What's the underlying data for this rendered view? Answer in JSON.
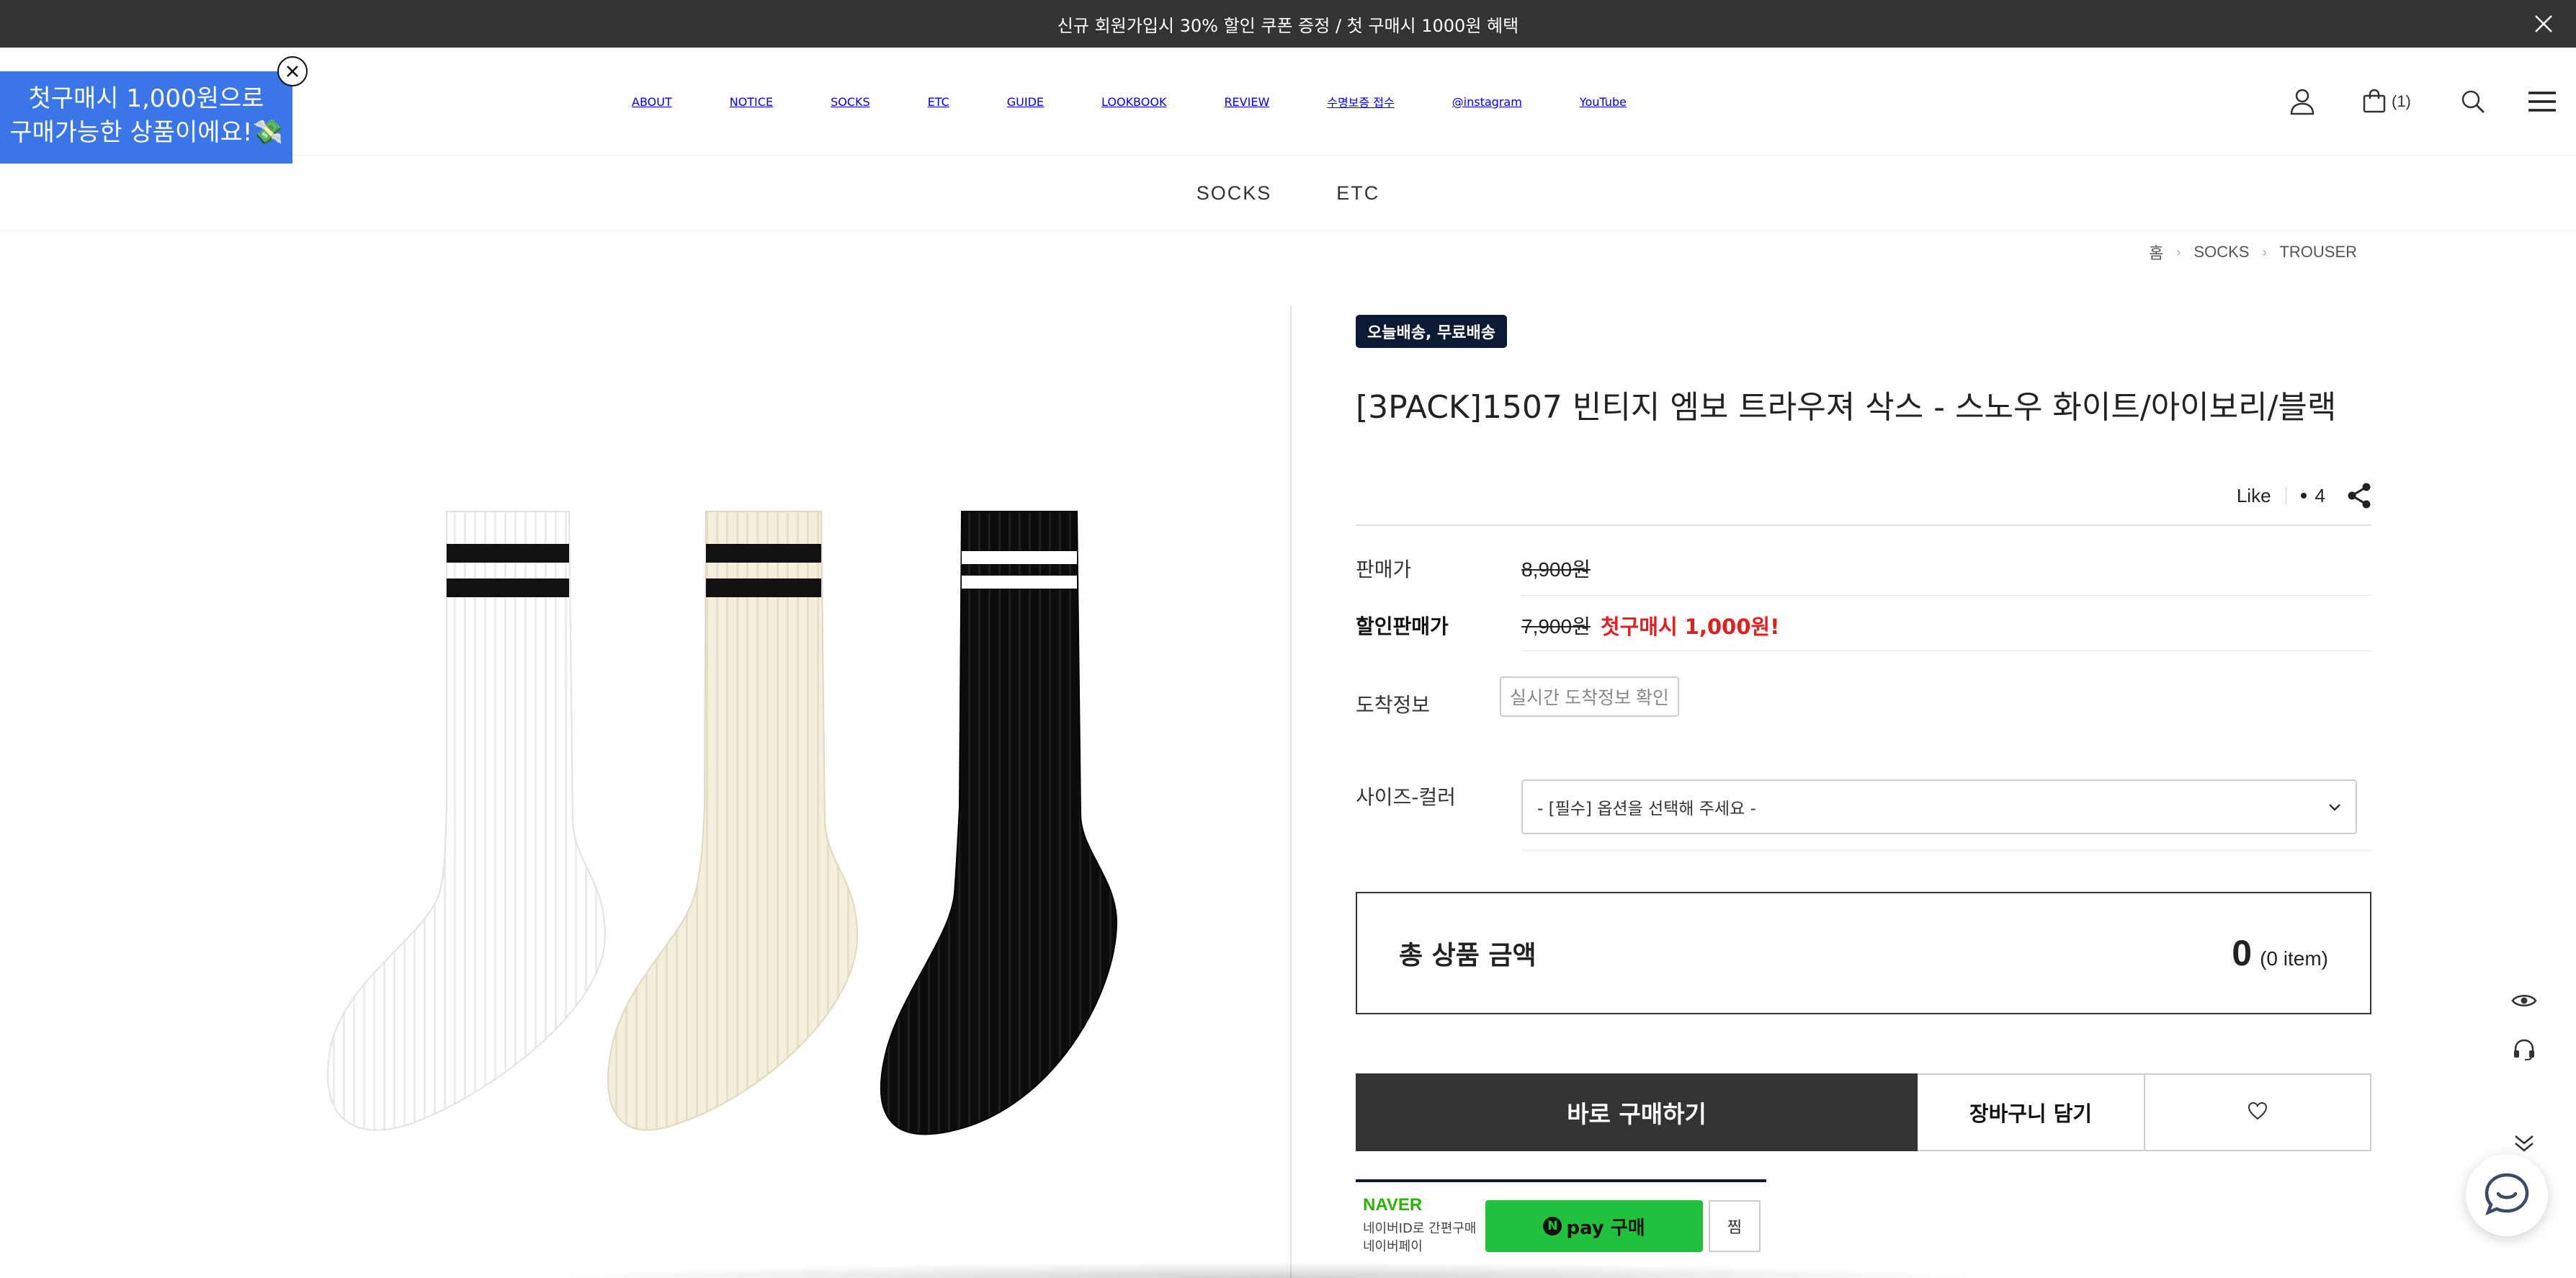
{
  "top_banner": {
    "text": "신규 회원가입시 30% 할인 쿠폰 증정 / 첫 구매시 1000원 혜택"
  },
  "promo_popup": {
    "line1": "첫구매시 1,000원으로",
    "line2": "구매가능한 상품이에요!💸"
  },
  "nav": {
    "items": [
      {
        "label": "ABOUT",
        "accent": false
      },
      {
        "label": "NOTICE",
        "accent": false
      },
      {
        "label": "SOCKS",
        "accent": true
      },
      {
        "label": "ETC",
        "accent": true
      },
      {
        "label": "GUIDE",
        "accent": false
      },
      {
        "label": "LOOKBOOK",
        "accent": false
      },
      {
        "label": "REVIEW",
        "accent": false
      },
      {
        "label": "수명보증 접수",
        "accent": false
      },
      {
        "label": "@instagram",
        "accent": false
      },
      {
        "label": "YouTube",
        "accent": false
      }
    ],
    "cart_count": "(1)",
    "accent_color": "#c2454e"
  },
  "subnav": {
    "items": [
      "SOCKS",
      "ETC"
    ]
  },
  "breadcrumb": {
    "items": [
      "홈",
      "SOCKS",
      "TROUSER"
    ]
  },
  "product": {
    "badge": "오늘배송, 무료배송",
    "title": "[3PACK]1507 빈티지 엠보 트라우져 삭스 - 스노우 화이트/아이보리/블랙",
    "like_label": "Like",
    "like_count": "4",
    "price_label": "판매가",
    "price": "8,900원",
    "sale_label": "할인판매가",
    "sale_price": "7,900원",
    "sale_note": "첫구매시 1,000원!",
    "arrival_label": "도착정보",
    "arrival_button": "실시간 도착정보 확인",
    "option_label": "사이즈-컬러",
    "option_placeholder": "- [필수] 옵션을 선택해 주세요 -",
    "total_label": "총 상품 금액",
    "total_value": "0",
    "total_items": "(0 item)",
    "buy_label": "바로 구매하기",
    "cart_label": "장바구니 담기",
    "naver_logo": "NAVER",
    "naver_line1": "네이버ID로 간편구매",
    "naver_line2": "네이버페이",
    "npay_label": "pay 구매",
    "npay_n": "N",
    "zzim_label": "찜"
  },
  "colors": {
    "banner_bg": "#333333",
    "promo_bg": "#3a76e8",
    "badge_bg": "#0c1a33",
    "sale_red": "#e02020",
    "npay_green": "#22c13d",
    "buy_bg": "#333333"
  },
  "icons": [
    "close-icon",
    "user-icon",
    "cart-icon",
    "search-icon",
    "menu-icon",
    "share-icon",
    "heart-icon",
    "eye-icon",
    "headset-icon",
    "chevron-double-down-icon",
    "chat-icon",
    "chevron-down-icon"
  ]
}
